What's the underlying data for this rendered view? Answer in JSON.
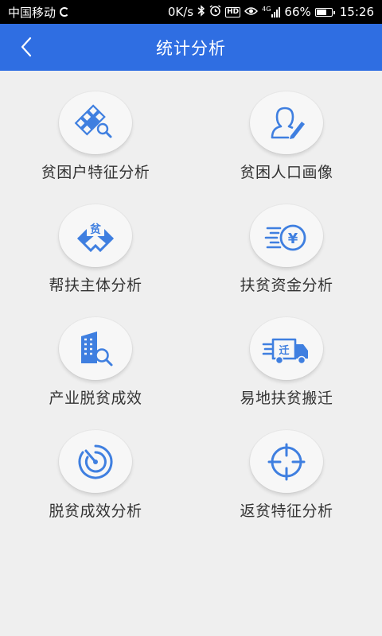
{
  "status_bar": {
    "carrier": "中国移动",
    "net_speed": "0K/s",
    "network": "4G",
    "battery": "66%",
    "battery_level": 0.66,
    "time": "15:26",
    "icons": [
      "loading-icon",
      "bluetooth-icon",
      "alarm-icon",
      "hd-icon",
      "eye-icon",
      "signal-icon",
      "battery-icon"
    ]
  },
  "header": {
    "title": "统计分析",
    "back_icon": "chevron-left-icon"
  },
  "colors": {
    "header_bg": "#2f6ee2",
    "icon_blue": "#3f7fe0",
    "page_bg": "#efefef"
  },
  "menu": {
    "items": [
      {
        "label": "贫困户特征分析",
        "icon": "grid-search-icon"
      },
      {
        "label": "贫困人口画像",
        "icon": "person-edit-icon"
      },
      {
        "label": "帮扶主体分析",
        "icon": "poverty-badge-icon",
        "icon_text": "贫"
      },
      {
        "label": "扶贫资金分析",
        "icon": "yuan-coin-icon",
        "icon_text": "¥"
      },
      {
        "label": "产业脱贫成效",
        "icon": "building-search-icon"
      },
      {
        "label": "易地扶贫搬迁",
        "icon": "moving-truck-icon",
        "icon_text": "迁"
      },
      {
        "label": "脱贫成效分析",
        "icon": "radar-icon"
      },
      {
        "label": "返贫特征分析",
        "icon": "crosshair-icon"
      }
    ]
  }
}
